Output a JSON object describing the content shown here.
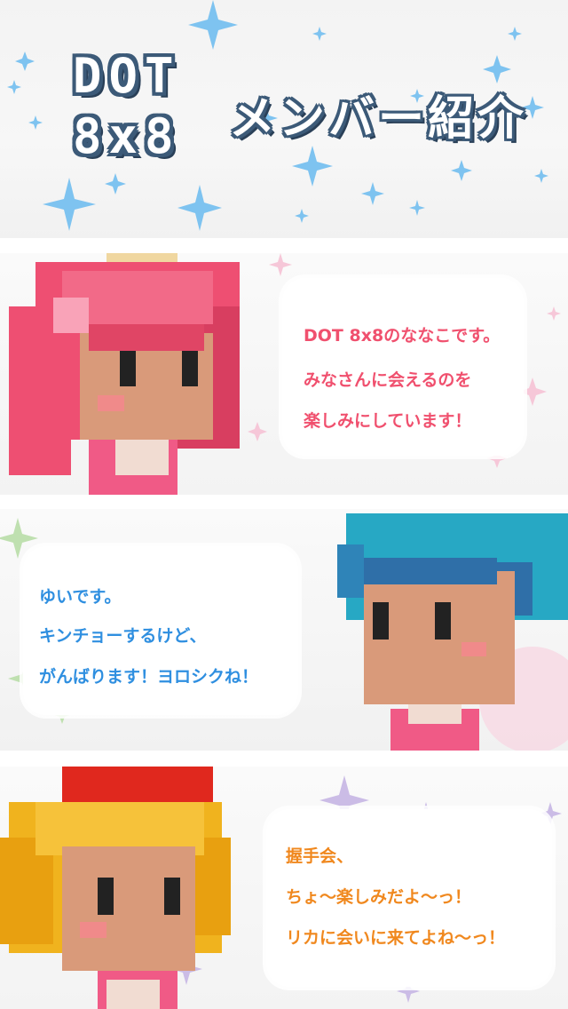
{
  "header": {
    "logo_line1": "DOT",
    "logo_line2": "8x8",
    "title": "メンバー紹介"
  },
  "members": [
    {
      "name": "ななこ",
      "lines": [
        "DOT 8x8のななこです。",
        "みなさんに会えるのを",
        "楽しみにしています！"
      ],
      "text_color": "#f0506e"
    },
    {
      "name": "ゆい",
      "lines": [
        "ゆいです。",
        "キンチョーするけど、",
        "がんばります！ヨロシクね！"
      ],
      "text_color": "#2f8fe0"
    },
    {
      "name": "リカ",
      "lines": [
        "握手会、",
        "ちょ〜楽しみだよ〜っ！",
        "リカに会いに来てよね〜っ！"
      ],
      "text_color": "#f0881e"
    }
  ],
  "colors": {
    "logo_fill": "#ffffff",
    "logo_outline": "#3c5a78",
    "sparkle_blue": "#7ec3f0",
    "sparkle_pink": "#f6c7d8",
    "sparkle_green": "#bfe0b0",
    "sparkle_purple": "#cbbce6"
  }
}
